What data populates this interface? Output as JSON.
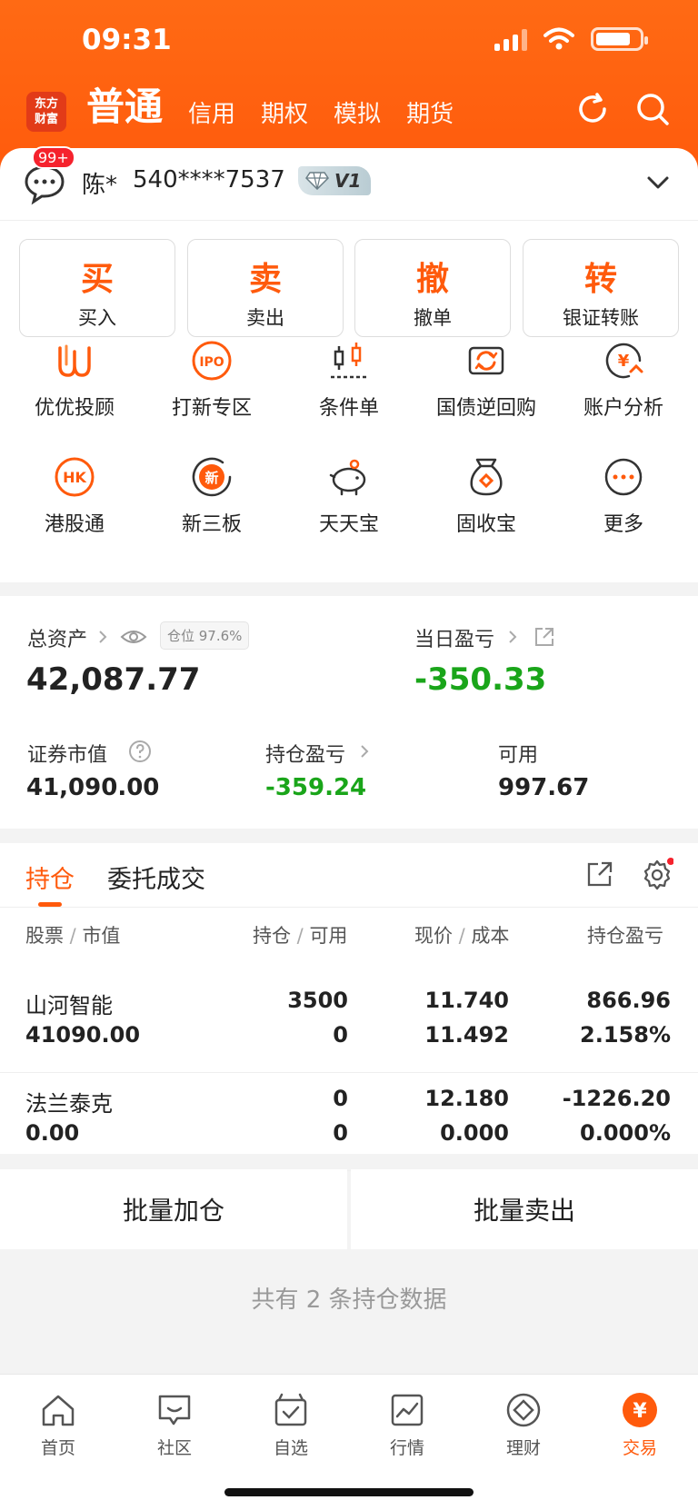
{
  "status_bar": {
    "time": "09:31"
  },
  "nav": {
    "logo_top": "东方",
    "logo_bottom": "财富",
    "tabs": [
      "普通",
      "信用",
      "期权",
      "模拟",
      "期货"
    ]
  },
  "account": {
    "badge": "99+",
    "name": "陈*",
    "number": "540****7537",
    "vip": "V1"
  },
  "actions": [
    {
      "char": "买",
      "label": "买入"
    },
    {
      "char": "卖",
      "label": "卖出"
    },
    {
      "char": "撤",
      "label": "撤单"
    },
    {
      "char": "转",
      "label": "银证转账"
    }
  ],
  "grid": [
    {
      "label": "优优投顾",
      "icon": "uu-advisor-icon"
    },
    {
      "label": "打新专区",
      "icon": "ipo-icon"
    },
    {
      "label": "条件单",
      "icon": "candlestick-icon"
    },
    {
      "label": "国债逆回购",
      "icon": "reverse-repo-icon"
    },
    {
      "label": "账户分析",
      "icon": "account-analysis-icon"
    },
    {
      "label": "港股通",
      "icon": "hk-icon"
    },
    {
      "label": "新三板",
      "icon": "neeq-icon"
    },
    {
      "label": "天天宝",
      "icon": "piggy-bank-icon"
    },
    {
      "label": "固收宝",
      "icon": "money-bag-icon"
    },
    {
      "label": "更多",
      "icon": "more-icon"
    }
  ],
  "assets": {
    "total_label": "总资产",
    "position_pill": "仓位 97.6%",
    "total_value": "42,087.77",
    "daily_label": "当日盈亏",
    "daily_value": "-350.33",
    "market_label": "证券市值",
    "market_value": "41,090.00",
    "holding_pl_label": "持仓盈亏",
    "holding_pl_value": "-359.24",
    "available_label": "可用",
    "available_value": "997.67"
  },
  "positions": {
    "tabs": [
      "持仓",
      "委托成交"
    ],
    "headers": {
      "col1a": "股票",
      "col1b": "市值",
      "col2a": "持仓",
      "col2b": "可用",
      "col3a": "现价",
      "col3b": "成本",
      "col4": "持仓盈亏"
    },
    "rows": [
      {
        "name": "山河智能",
        "mv": "41090.00",
        "hold": "3500",
        "avail": "0",
        "price": "11.740",
        "cost": "11.492",
        "pl": "866.96",
        "plpct": "2.158%",
        "color": "#e6202e"
      },
      {
        "name": "法兰泰克",
        "mv": "0.00",
        "hold": "0",
        "avail": "0",
        "price": "12.180",
        "cost": "0.000",
        "pl": "-1226.20",
        "plpct": "0.000%",
        "color": "#1aa51a"
      }
    ]
  },
  "bulk": {
    "add": "批量加仓",
    "sell": "批量卖出"
  },
  "footer": "共有 2 条持仓数据",
  "bottom_nav": [
    {
      "label": "首页",
      "icon": "home-icon"
    },
    {
      "label": "社区",
      "icon": "community-icon"
    },
    {
      "label": "自选",
      "icon": "watchlist-icon"
    },
    {
      "label": "行情",
      "icon": "market-icon"
    },
    {
      "label": "理财",
      "icon": "wealth-icon"
    },
    {
      "label": "交易",
      "icon": "trade-icon"
    }
  ],
  "colors": {
    "accent": "#ff5a0c",
    "up": "#e6202e",
    "down": "#1aa51a"
  }
}
